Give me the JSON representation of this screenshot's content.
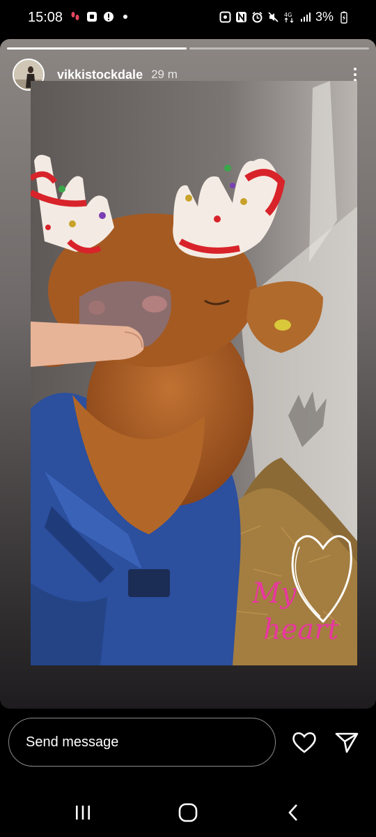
{
  "status_bar": {
    "time": "15:08",
    "left_icons": [
      "footprints-icon",
      "notification-square-icon",
      "alert-circle-icon",
      "dot-icon"
    ],
    "right_icons": [
      "nfc-icon",
      "n-badge-icon",
      "alarm-icon",
      "mute-icon",
      "4g-data-icon",
      "signal-icon"
    ],
    "battery": "3%",
    "network": "4G"
  },
  "story": {
    "username": "vikkistockdale",
    "time_ago": "29 m",
    "segments": [
      1.0,
      0.0
    ],
    "sticker_text": {
      "line1": "My",
      "line2": "heart"
    }
  },
  "reply": {
    "placeholder": "Send message"
  },
  "colors": {
    "sticker_pink": "#e8379f",
    "calf_brown": "#a55a22",
    "jacket_blue": "#2c4f9e"
  }
}
